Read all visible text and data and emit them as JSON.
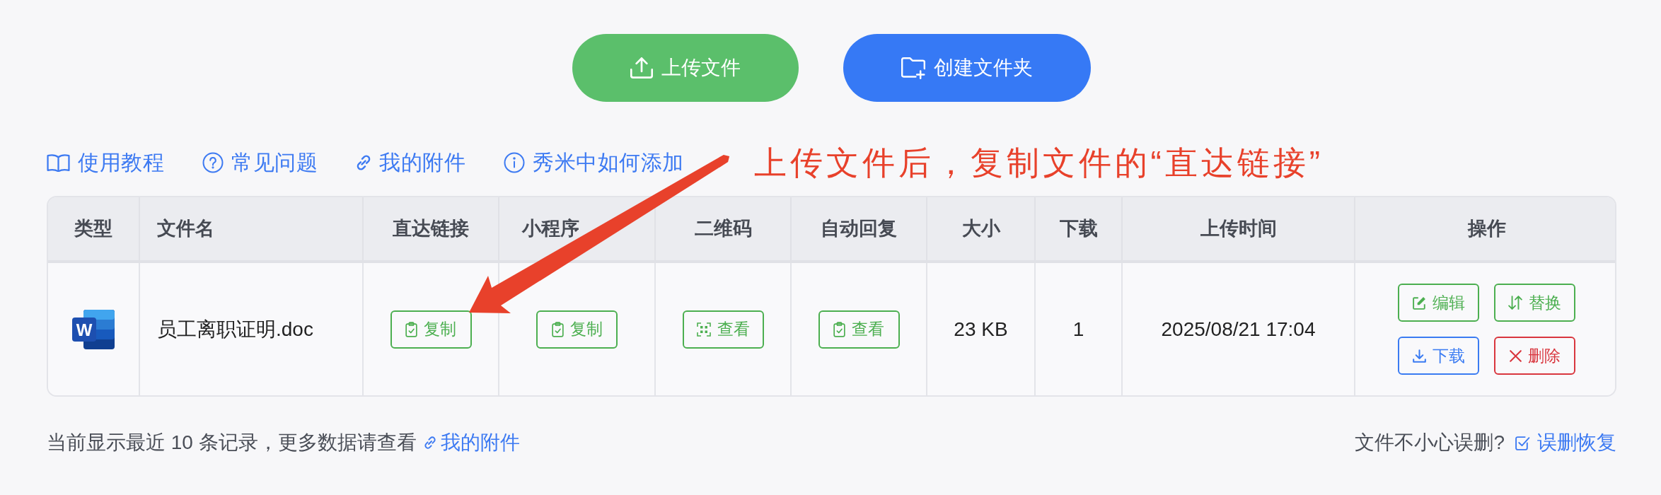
{
  "toolbar": {
    "buttons": [
      {
        "label": "上传文件",
        "kind": "upload",
        "color": "#5bbf6b"
      },
      {
        "label": "创建文件夹",
        "kind": "folder",
        "color": "#3679f5"
      }
    ]
  },
  "help_links": [
    {
      "label": "使用教程",
      "kind": "book"
    },
    {
      "label": "常见问题",
      "kind": "question"
    },
    {
      "label": "我的附件",
      "kind": "link"
    },
    {
      "label": "秀米中如何添加",
      "kind": "info"
    }
  ],
  "annotation": {
    "text": "上传文件后，复制文件的“直达链接”"
  },
  "table": {
    "columns": [
      "类型",
      "文件名",
      "直达链接",
      "小程序",
      "二维码",
      "自动回复",
      "大小",
      "下载",
      "上传时间",
      "操作"
    ],
    "rows": [
      {
        "type_icon_text": "W",
        "file_name": "员工离职证明.doc",
        "direct_link": {
          "label": "复制"
        },
        "mini_program_path": {
          "label": "复制"
        },
        "qr_code": {
          "label": "查看"
        },
        "auto_reply": {
          "label": "查看"
        },
        "size": "23 KB",
        "downloads": "1",
        "upload_time": "2025/08/21 17:04",
        "actions": [
          {
            "label": "编辑",
            "kind": "edit",
            "color": "#4caf50"
          },
          {
            "label": "替换",
            "kind": "replace",
            "color": "#4caf50"
          },
          {
            "label": "下载",
            "kind": "download",
            "color": "#3a7bf2"
          },
          {
            "label": "删除",
            "kind": "delete",
            "color": "#d9363e"
          }
        ]
      }
    ]
  },
  "footer": {
    "note": "当前显示最近 10 条记录，更多数据请查看",
    "note_link": "我的附件",
    "prompt": "文件不小心误删?",
    "recover_link": "误删恢复"
  }
}
